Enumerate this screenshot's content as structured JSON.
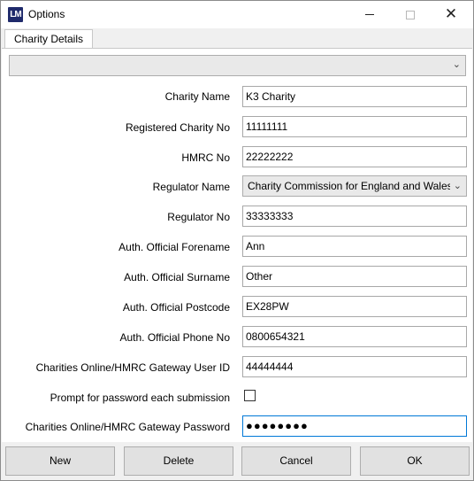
{
  "window": {
    "icon_text": "LM",
    "title": "Options"
  },
  "tabs": [
    {
      "label": "Charity Details"
    }
  ],
  "top_selector": {
    "value": ""
  },
  "fields": {
    "charity_name": {
      "label": "Charity Name",
      "value": "K3 Charity"
    },
    "registered_charity_no": {
      "label": "Registered Charity No",
      "value": "11111111"
    },
    "hmrc_no": {
      "label": "HMRC No",
      "value": "22222222"
    },
    "regulator_name": {
      "label": "Regulator Name",
      "value": "Charity Commission for England and Wales"
    },
    "regulator_no": {
      "label": "Regulator No",
      "value": "33333333"
    },
    "official_forename": {
      "label": "Auth. Official Forename",
      "value": "Ann"
    },
    "official_surname": {
      "label": "Auth. Official Surname",
      "value": "Other"
    },
    "official_postcode": {
      "label": "Auth. Official Postcode",
      "value": "EX28PW"
    },
    "official_phone": {
      "label": "Auth. Official Phone No",
      "value": "0800654321"
    },
    "gateway_user_id": {
      "label": "Charities Online/HMRC Gateway User ID",
      "value": "44444444"
    },
    "prompt_password": {
      "label": "Prompt for password each submission",
      "checked": false
    },
    "gateway_password": {
      "label": "Charities Online/HMRC Gateway Password",
      "value": "●●●●●●●●"
    }
  },
  "buttons": {
    "new": "New",
    "delete": "Delete",
    "cancel": "Cancel",
    "ok": "OK"
  },
  "icons": {
    "app": "app-logo-icon",
    "minimize": "minimize-icon",
    "maximize": "maximize-icon",
    "close": "close-icon",
    "dropdown": "chevron-down-icon"
  }
}
